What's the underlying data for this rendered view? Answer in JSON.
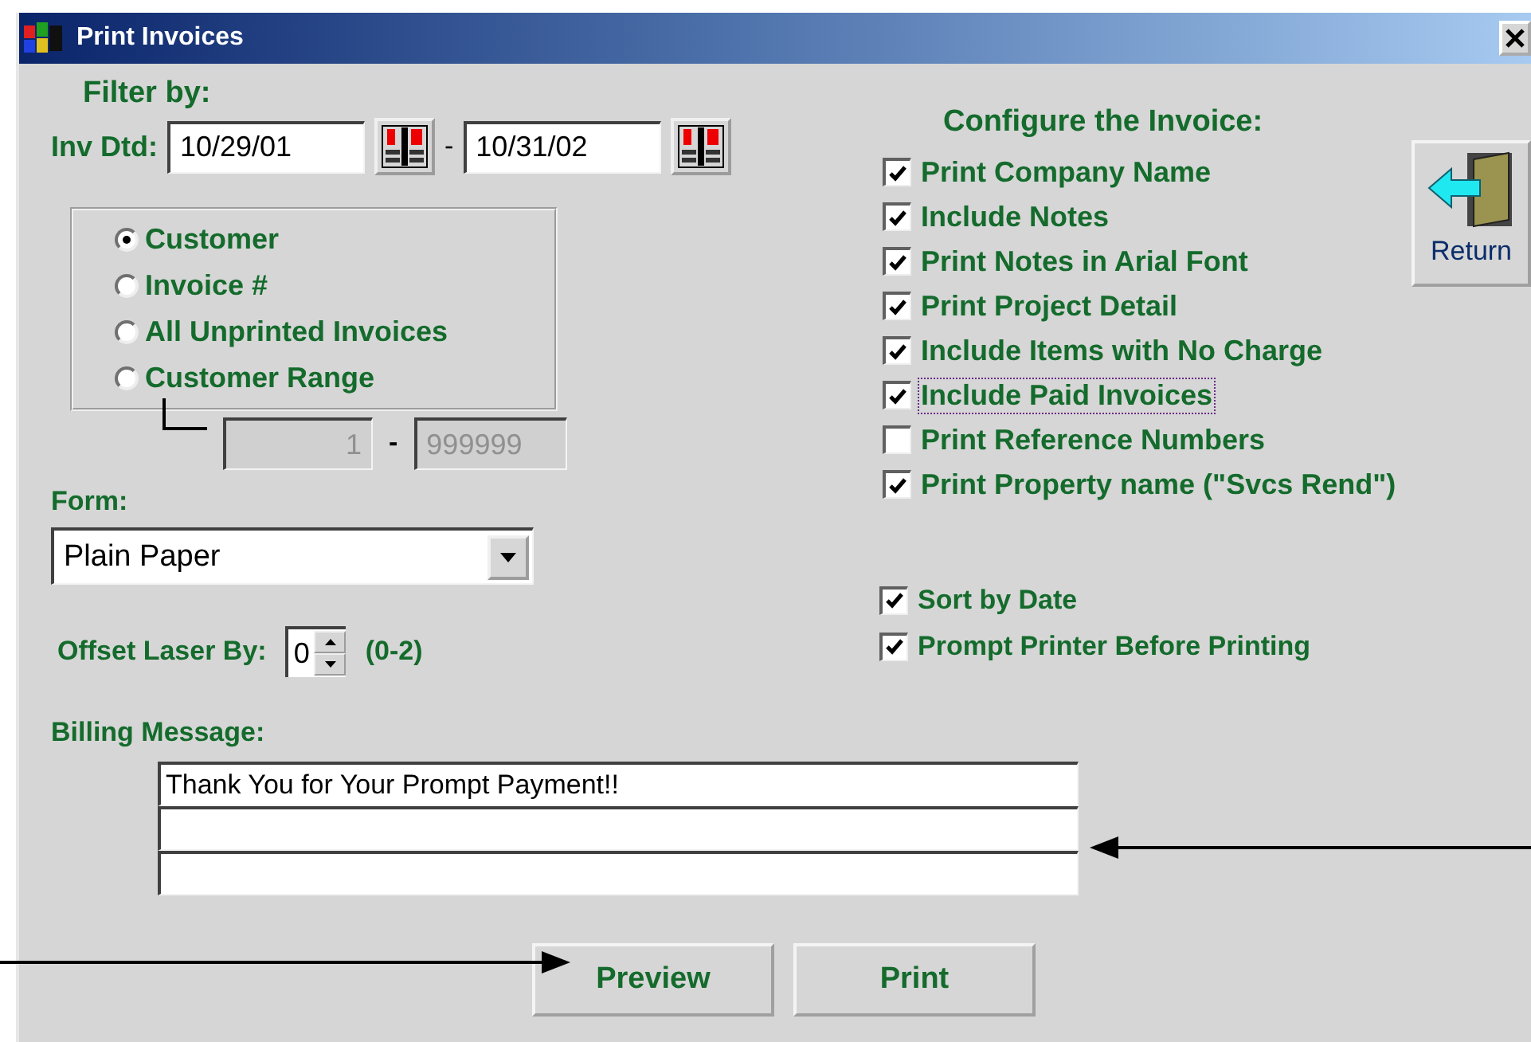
{
  "window": {
    "title": "Print Invoices"
  },
  "filter": {
    "heading": "Filter by:",
    "date_label": "Inv Dtd:",
    "date_from": "10/29/01",
    "date_separator": "-",
    "date_to": "10/31/02",
    "options": [
      {
        "label": "Customer",
        "selected": true
      },
      {
        "label": "Invoice #",
        "selected": false
      },
      {
        "label": "All Unprinted Invoices",
        "selected": false
      },
      {
        "label": "Customer Range",
        "selected": false
      }
    ],
    "range": {
      "from": "1",
      "separator": "-",
      "to": "999999",
      "disabled": true
    }
  },
  "form": {
    "label": "Form:",
    "value": "Plain Paper"
  },
  "offset": {
    "label": "Offset Laser By:",
    "value": "0",
    "hint": "(0-2)"
  },
  "configure": {
    "heading": "Configure the Invoice:",
    "options": [
      {
        "label": "Print Company Name",
        "checked": true,
        "focused": false
      },
      {
        "label": "Include Notes",
        "checked": true,
        "focused": false
      },
      {
        "label": "Print Notes in Arial Font",
        "checked": true,
        "focused": false
      },
      {
        "label": "Print Project Detail",
        "checked": true,
        "focused": false
      },
      {
        "label": "Include Items with No Charge",
        "checked": true,
        "focused": false
      },
      {
        "label": "Include Paid Invoices",
        "checked": true,
        "focused": true
      },
      {
        "label": "Print Reference Numbers",
        "checked": false,
        "focused": false
      },
      {
        "label": "Print Property name (\"Svcs Rend\")",
        "checked": true,
        "focused": false
      }
    ]
  },
  "sorting": [
    {
      "label": "Sort by Date",
      "checked": true
    },
    {
      "label": "Prompt Printer Before Printing",
      "checked": true
    }
  ],
  "return_button": {
    "label": "Return"
  },
  "billing": {
    "label": "Billing Message:",
    "lines": [
      "Thank You for Your Prompt Payment!!"
    ]
  },
  "buttons": [
    {
      "label": "Preview"
    },
    {
      "label": "Print"
    }
  ]
}
